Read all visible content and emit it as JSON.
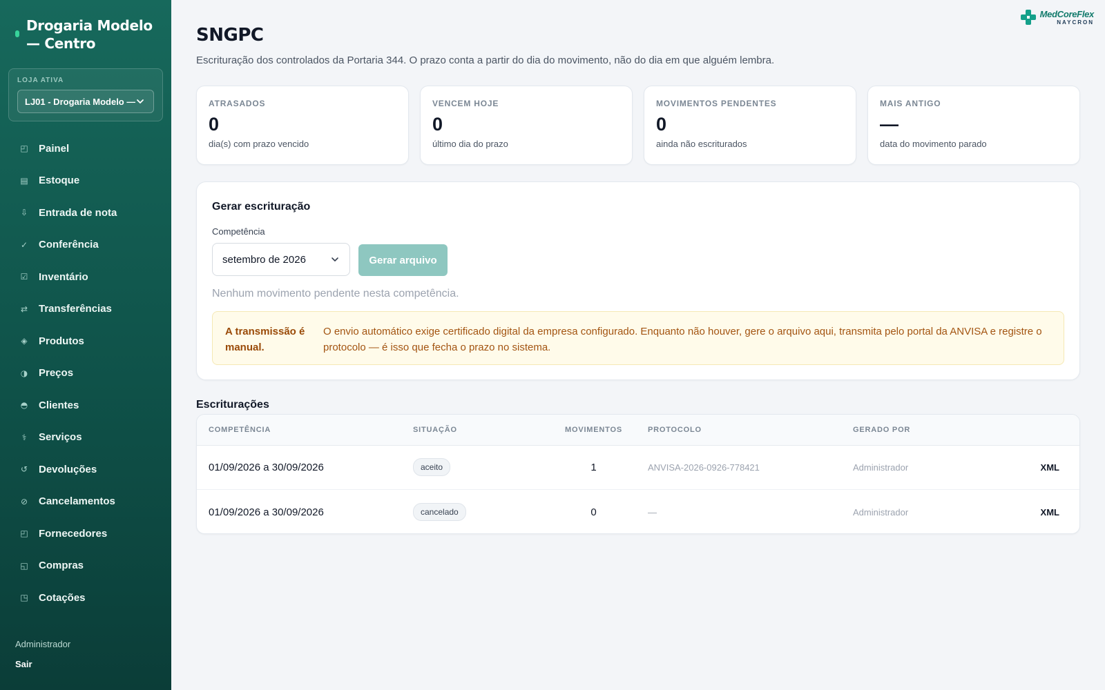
{
  "sidebar": {
    "brand": "Drogaria Modelo — Centro",
    "store_label": "LOJA ATIVA",
    "store_value": "LJ01 - Drogaria Modelo —",
    "items": [
      {
        "label": "Painel",
        "icon": "◰"
      },
      {
        "label": "Estoque",
        "icon": "▤"
      },
      {
        "label": "Entrada de nota",
        "icon": "⇩"
      },
      {
        "label": "Conferência",
        "icon": "✓"
      },
      {
        "label": "Inventário",
        "icon": "☑"
      },
      {
        "label": "Transferências",
        "icon": "⇄"
      },
      {
        "label": "Produtos",
        "icon": "◈"
      },
      {
        "label": "Preços",
        "icon": "◑"
      },
      {
        "label": "Clientes",
        "icon": "◓"
      },
      {
        "label": "Serviços",
        "icon": "⚕"
      },
      {
        "label": "Devoluções",
        "icon": "↺"
      },
      {
        "label": "Cancelamentos",
        "icon": "⊘"
      },
      {
        "label": "Fornecedores",
        "icon": "◰"
      },
      {
        "label": "Compras",
        "icon": "◱"
      },
      {
        "label": "Cotações",
        "icon": "◳"
      }
    ],
    "user": "Administrador",
    "logout": "Sair"
  },
  "logo": {
    "name": "MedCoreFlex",
    "sub": "NAYCRON"
  },
  "page": {
    "title": "SNGPC",
    "subtitle": "Escrituração dos controlados da Portaria 344. O prazo conta a partir do dia do movimento, não do dia em que alguém lembra."
  },
  "stats": [
    {
      "label": "ATRASADOS",
      "value": "0",
      "hint": "dia(s) com prazo vencido"
    },
    {
      "label": "VENCEM HOJE",
      "value": "0",
      "hint": "último dia do prazo"
    },
    {
      "label": "MOVIMENTOS PENDENTES",
      "value": "0",
      "hint": "ainda não escriturados"
    },
    {
      "label": "MAIS ANTIGO",
      "value": "—",
      "hint": "data do movimento parado"
    }
  ],
  "generate": {
    "title": "Gerar escrituração",
    "competencia_label": "Competência",
    "competencia_value": "setembro de 2026",
    "button": "Gerar arquivo",
    "empty": "Nenhum movimento pendente nesta competência.",
    "alert_title": "A transmissão é manual.",
    "alert_text": "O envio automático exige certificado digital da empresa configurado. Enquanto não houver, gere o arquivo aqui, transmita pelo portal da ANVISA e registre o protocolo — é isso que fecha o prazo no sistema."
  },
  "table": {
    "title": "Escriturações",
    "headers": [
      "COMPETÊNCIA",
      "SITUAÇÃO",
      "MOVIMENTOS",
      "PROTOCOLO",
      "GERADO POR",
      ""
    ],
    "rows": [
      {
        "competencia": "01/09/2026 a 30/09/2026",
        "situacao": "aceito",
        "movimentos": "1",
        "protocolo": "ANVISA-2026-0926-778421",
        "gerado_por": "Administrador",
        "acao": "XML"
      },
      {
        "competencia": "01/09/2026 a 30/09/2026",
        "situacao": "cancelado",
        "movimentos": "0",
        "protocolo": "—",
        "gerado_por": "Administrador",
        "acao": "XML"
      }
    ]
  },
  "colors": {
    "sidebar": "#0f5249",
    "accent": "#37d39a",
    "button_disabled": "#8ec7c0",
    "alert_bg": "#fffbea",
    "alert_text": "#9a4a08"
  }
}
